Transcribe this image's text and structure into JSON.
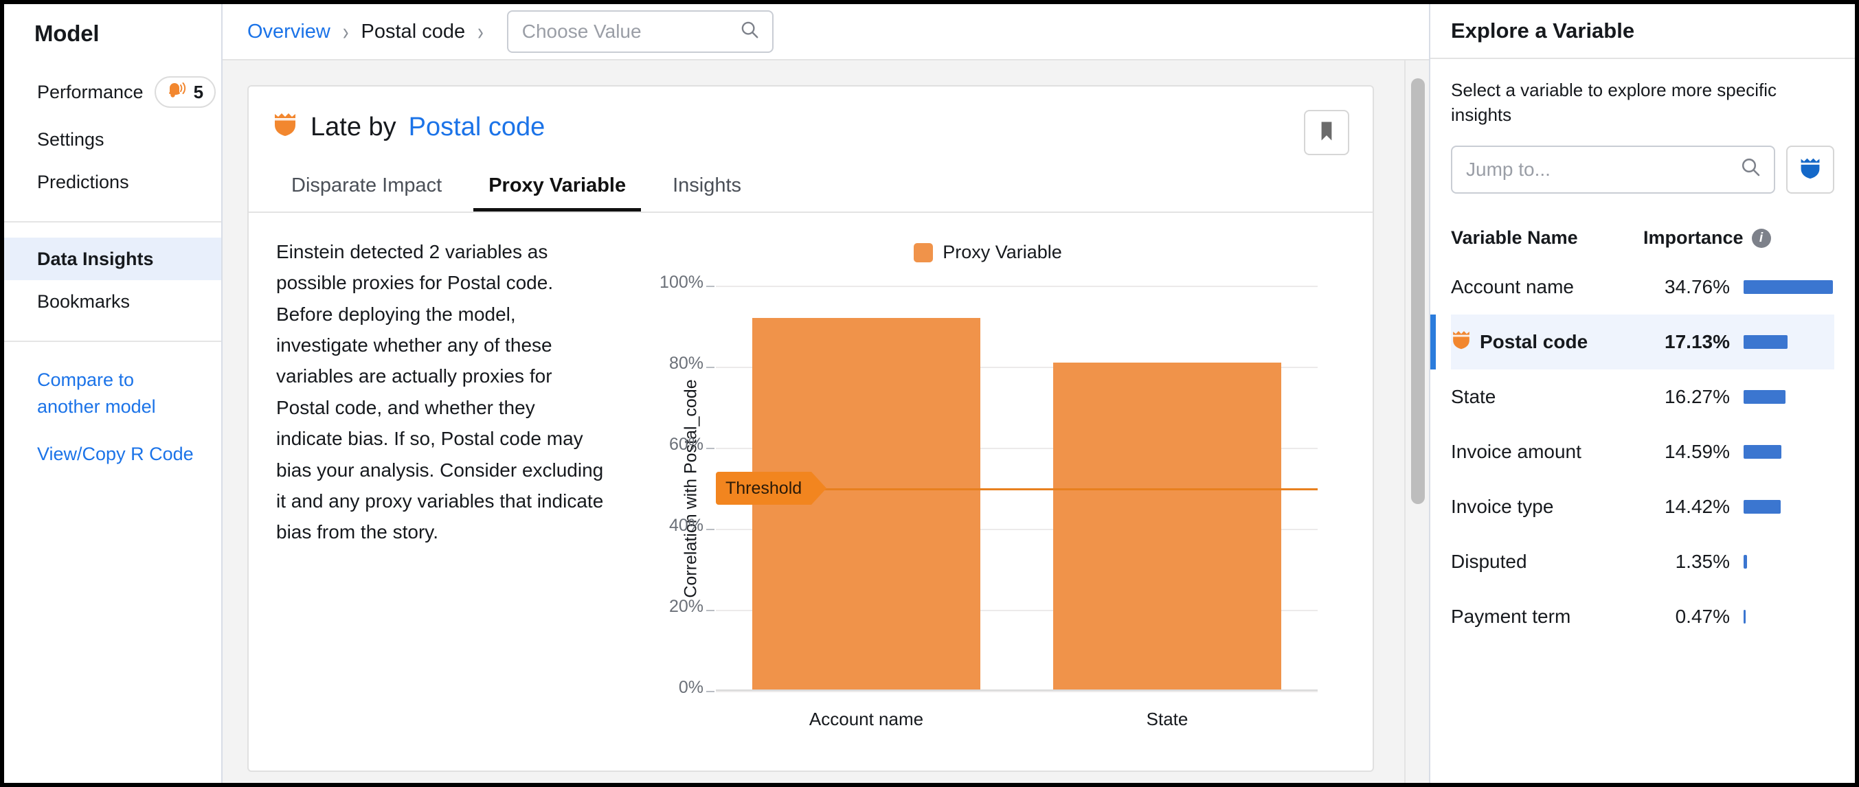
{
  "sidebar": {
    "title": "Model",
    "groups": [
      {
        "items": [
          {
            "label": "Performance",
            "badge": "5",
            "badge_icon": "bell-icon"
          },
          {
            "label": "Settings"
          },
          {
            "label": "Predictions"
          }
        ]
      },
      {
        "items": [
          {
            "label": "Data Insights",
            "active": true
          },
          {
            "label": "Bookmarks"
          }
        ]
      }
    ],
    "links": [
      "Compare to another model",
      "View/Copy R Code"
    ]
  },
  "breadcrumb": {
    "items": [
      "Overview",
      "Postal code"
    ],
    "separator": "›",
    "choose_value_placeholder": "Choose Value",
    "search_icon": "search-icon"
  },
  "card": {
    "title_prefix": "Late by",
    "title_variable": "Postal code",
    "title_icon": "orange-shield-icon",
    "bookmark_icon": "bookmark-icon",
    "tabs": [
      {
        "label": "Disparate Impact",
        "active": false
      },
      {
        "label": "Proxy Variable",
        "active": true
      },
      {
        "label": "Insights",
        "active": false
      }
    ],
    "description": "Einstein detected 2 variables as possible proxies for Postal code. Before deploying the model, investigate whether any of these variables are actually proxies for Postal code, and whether they indicate bias. If so, Postal code may bias your analysis. Consider excluding it and any proxy variables that indicate bias from the story."
  },
  "chart_data": {
    "type": "bar",
    "title": "",
    "legend": [
      {
        "name": "Proxy Variable",
        "color": "#f0934a"
      }
    ],
    "legend_position": "top-center",
    "categories": [
      "Account name",
      "State"
    ],
    "values": [
      92,
      81
    ],
    "series": [
      {
        "name": "Proxy Variable",
        "values": [
          92,
          81
        ]
      }
    ],
    "xlabel": "",
    "ylabel": "Correlation with Postal_code",
    "ylim": [
      0,
      100
    ],
    "yticks": [
      0,
      20,
      40,
      60,
      80,
      100
    ],
    "ytick_labels": [
      "0%",
      "20%",
      "40%",
      "60%",
      "80%",
      "100%"
    ],
    "grid": true,
    "annotations": [
      {
        "type": "threshold-line",
        "label": "Threshold",
        "value": 50,
        "color": "#e8801f"
      }
    ]
  },
  "right_panel": {
    "title": "Explore a Variable",
    "hint": "Select a variable to explore more specific insights",
    "search_placeholder": "Jump to...",
    "search_icon": "search-icon",
    "shield_button_icon": "blue-shield-icon",
    "columns": {
      "name": "Variable Name",
      "importance": "Importance"
    },
    "info_icon": "info-icon",
    "rows": [
      {
        "name": "Account name",
        "importance": "34.76%",
        "bar_pct": 34.76,
        "selected": false,
        "icon": null
      },
      {
        "name": "Postal code",
        "importance": "17.13%",
        "bar_pct": 17.13,
        "selected": true,
        "icon": "orange-shield-icon"
      },
      {
        "name": "State",
        "importance": "16.27%",
        "bar_pct": 16.27,
        "selected": false,
        "icon": null
      },
      {
        "name": "Invoice amount",
        "importance": "14.59%",
        "bar_pct": 14.59,
        "selected": false,
        "icon": null
      },
      {
        "name": "Invoice type",
        "importance": "14.42%",
        "bar_pct": 14.42,
        "selected": false,
        "icon": null
      },
      {
        "name": "Disputed",
        "importance": "1.35%",
        "bar_pct": 1.35,
        "selected": false,
        "icon": null
      },
      {
        "name": "Payment term",
        "importance": "0.47%",
        "bar_pct": 0.47,
        "selected": false,
        "icon": null
      }
    ]
  },
  "colors": {
    "accent_blue": "#1b73e8",
    "bar_blue": "#3b76d0",
    "chart_orange": "#f0934a",
    "threshold_orange": "#e8801f",
    "selected_row_bg": "#eff4fd"
  }
}
